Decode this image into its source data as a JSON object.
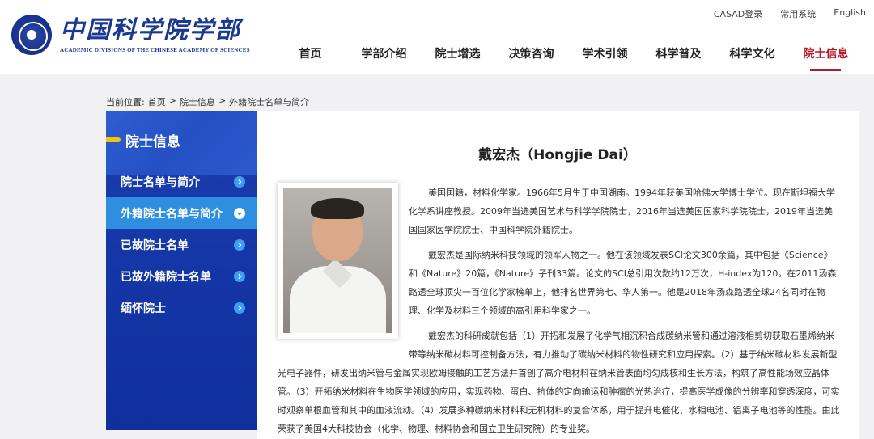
{
  "header": {
    "logo_cn": "中国科学院学部",
    "logo_en": "ACADEMIC DIVISIONS OF THE CHINESE ACADEMY OF SCIENCES",
    "utility": [
      "CASAD登录",
      "常用系统",
      "English"
    ],
    "nav": [
      "首页",
      "学部介绍",
      "院士增选",
      "决策咨询",
      "学术引领",
      "科学普及",
      "科学文化",
      "院士信息"
    ],
    "active_nav": "院士信息",
    "accent_color": "#b4182c"
  },
  "breadcrumb": {
    "label": "当前位置:",
    "items": [
      "首页",
      "院士信息",
      "外籍院士名单与简介"
    ],
    "separator": ">"
  },
  "sidebar": {
    "title": "院士信息",
    "items": [
      {
        "label": "院士名单与简介",
        "icon": "chevron-right-icon"
      },
      {
        "label": "外籍院士名单与简介",
        "icon": "chevron-down-icon"
      },
      {
        "label": "已故院士名单",
        "icon": "chevron-right-icon"
      },
      {
        "label": "已故外籍院士名单",
        "icon": "chevron-right-icon"
      },
      {
        "label": "缅怀院士",
        "icon": "chevron-right-icon"
      }
    ],
    "active_item": "外籍院士名单与简介",
    "colors": {
      "background": "#1536a6",
      "active": "#2e8ee0",
      "bullet": "#f5c400"
    }
  },
  "profile": {
    "name": "戴宏杰（Hongjie Dai）",
    "paragraphs": [
      "美国国籍，材料化学家。1966年5月生于中国湖南。1994年获美国哈佛大学博士学位。现在斯坦福大学化学系讲座教授。2009年当选美国艺术与科学学院院士，2016年当选美国国家科学院院士，2019年当选美国国家医学院院士、中国科学院外籍院士。",
      "戴宏杰是国际纳米科技领域的领军人物之一。他在该领域发表SCI论文300余篇，其中包括《Science》和《Nature》20篇，《Nature》子刊33篇。论文的SCI总引用次数约12万次，H-index为120。在2011汤森路透全球顶尖一百位化学家榜单上，他排名世界第七、华人第一。他是2018年汤森路透全球24名同时在物理、化学及材料三个领域的高引用科学家之一。",
      "戴宏杰的科研成就包括（1）开拓和发展了化学气相沉积合成碳纳米管和通过溶液相剪切获取石墨烯纳米带等纳米碳材料可控制备方法，有力推动了碳纳米材料的物性研究和应用探索。（2）基于纳米碳材料发展新型光电子器件，研发出纳米管与金属实现欧姆接触的工艺方法并首创了高介电材料在纳米管表面均匀成核和生长方法，构筑了高性能场效应晶体管。（3）开拓纳米材料在生物医学领域的应用，实现药物、蛋白、抗体的定向输运和肿瘤的光热治疗，提高医学成像的分辨率和穿透深度，可实时观察单根血管和其中的血液流动。（4）发展多种碳纳米材料和无机材料的复合体系，用于提升电催化、水相电池、铝离子电池等的性能。由此荣获了美国4大科技协会（化学、物理、材料协会和国立卫生研究院）的专业奖。"
    ]
  }
}
